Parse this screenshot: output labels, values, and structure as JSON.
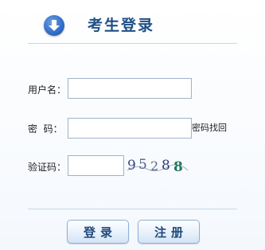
{
  "header": {
    "title": "考生登录",
    "icon": "download-arrow-icon",
    "icon_color": "#2f6cc8"
  },
  "form": {
    "username_label": "用户名：",
    "username_value": "",
    "password_label": "密  码：",
    "password_value": "",
    "forgot_password_link": "密码找回",
    "captcha_label": "验证码：",
    "captcha_value": "",
    "captcha_image_text": "95288"
  },
  "buttons": {
    "login_label": "登录",
    "register_label": "注册"
  },
  "colors": {
    "title": "#1f4f86",
    "button_text": "#214a7a"
  }
}
